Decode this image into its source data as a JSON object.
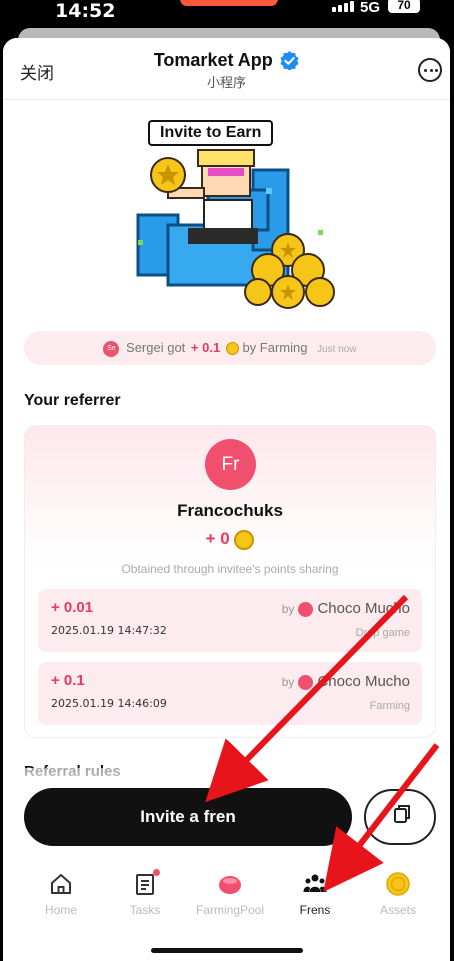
{
  "status_bar": {
    "time": "14:52",
    "network": "5G",
    "battery": "70"
  },
  "header": {
    "close_label": "关闭",
    "app_title": "Tomarket App",
    "subtitle": "小程序"
  },
  "hero": {
    "bubble_text": "Invite to Earn"
  },
  "ticker": {
    "avatar_initials": "Se",
    "user": "Sergei got",
    "amount": "+ 0.1",
    "by_text": "by Farming",
    "time": "Just now"
  },
  "referrer_section": {
    "title": "Your referrer",
    "avatar_initials": "Fr",
    "name": "Francochuks",
    "points": "+ 0",
    "note": "Obtained through invitee's points sharing",
    "records": [
      {
        "amount": "+ 0.01",
        "datetime": "2025.01.19 14:47:32",
        "by_label": "by",
        "user": "Choco Mucho",
        "source": "Drop game"
      },
      {
        "amount": "+ 0.1",
        "datetime": "2025.01.19 14:46:09",
        "by_label": "by",
        "user": "Choco Mucho",
        "source": "Farming"
      }
    ]
  },
  "rules_title": "Referral rules",
  "cta": {
    "invite_label": "Invite a fren"
  },
  "tabs": [
    {
      "label": "Home",
      "icon": "home-icon"
    },
    {
      "label": "Tasks",
      "icon": "tasks-icon"
    },
    {
      "label": "FarmingPool",
      "icon": "farming-pool-icon"
    },
    {
      "label": "Frens",
      "icon": "frens-icon",
      "active": true
    },
    {
      "label": "Assets",
      "icon": "assets-icon"
    }
  ],
  "colors": {
    "accent": "#E83A5F",
    "avatar": "#F0506E",
    "annotation_arrow": "#E8141B",
    "primary_button": "#111111"
  }
}
